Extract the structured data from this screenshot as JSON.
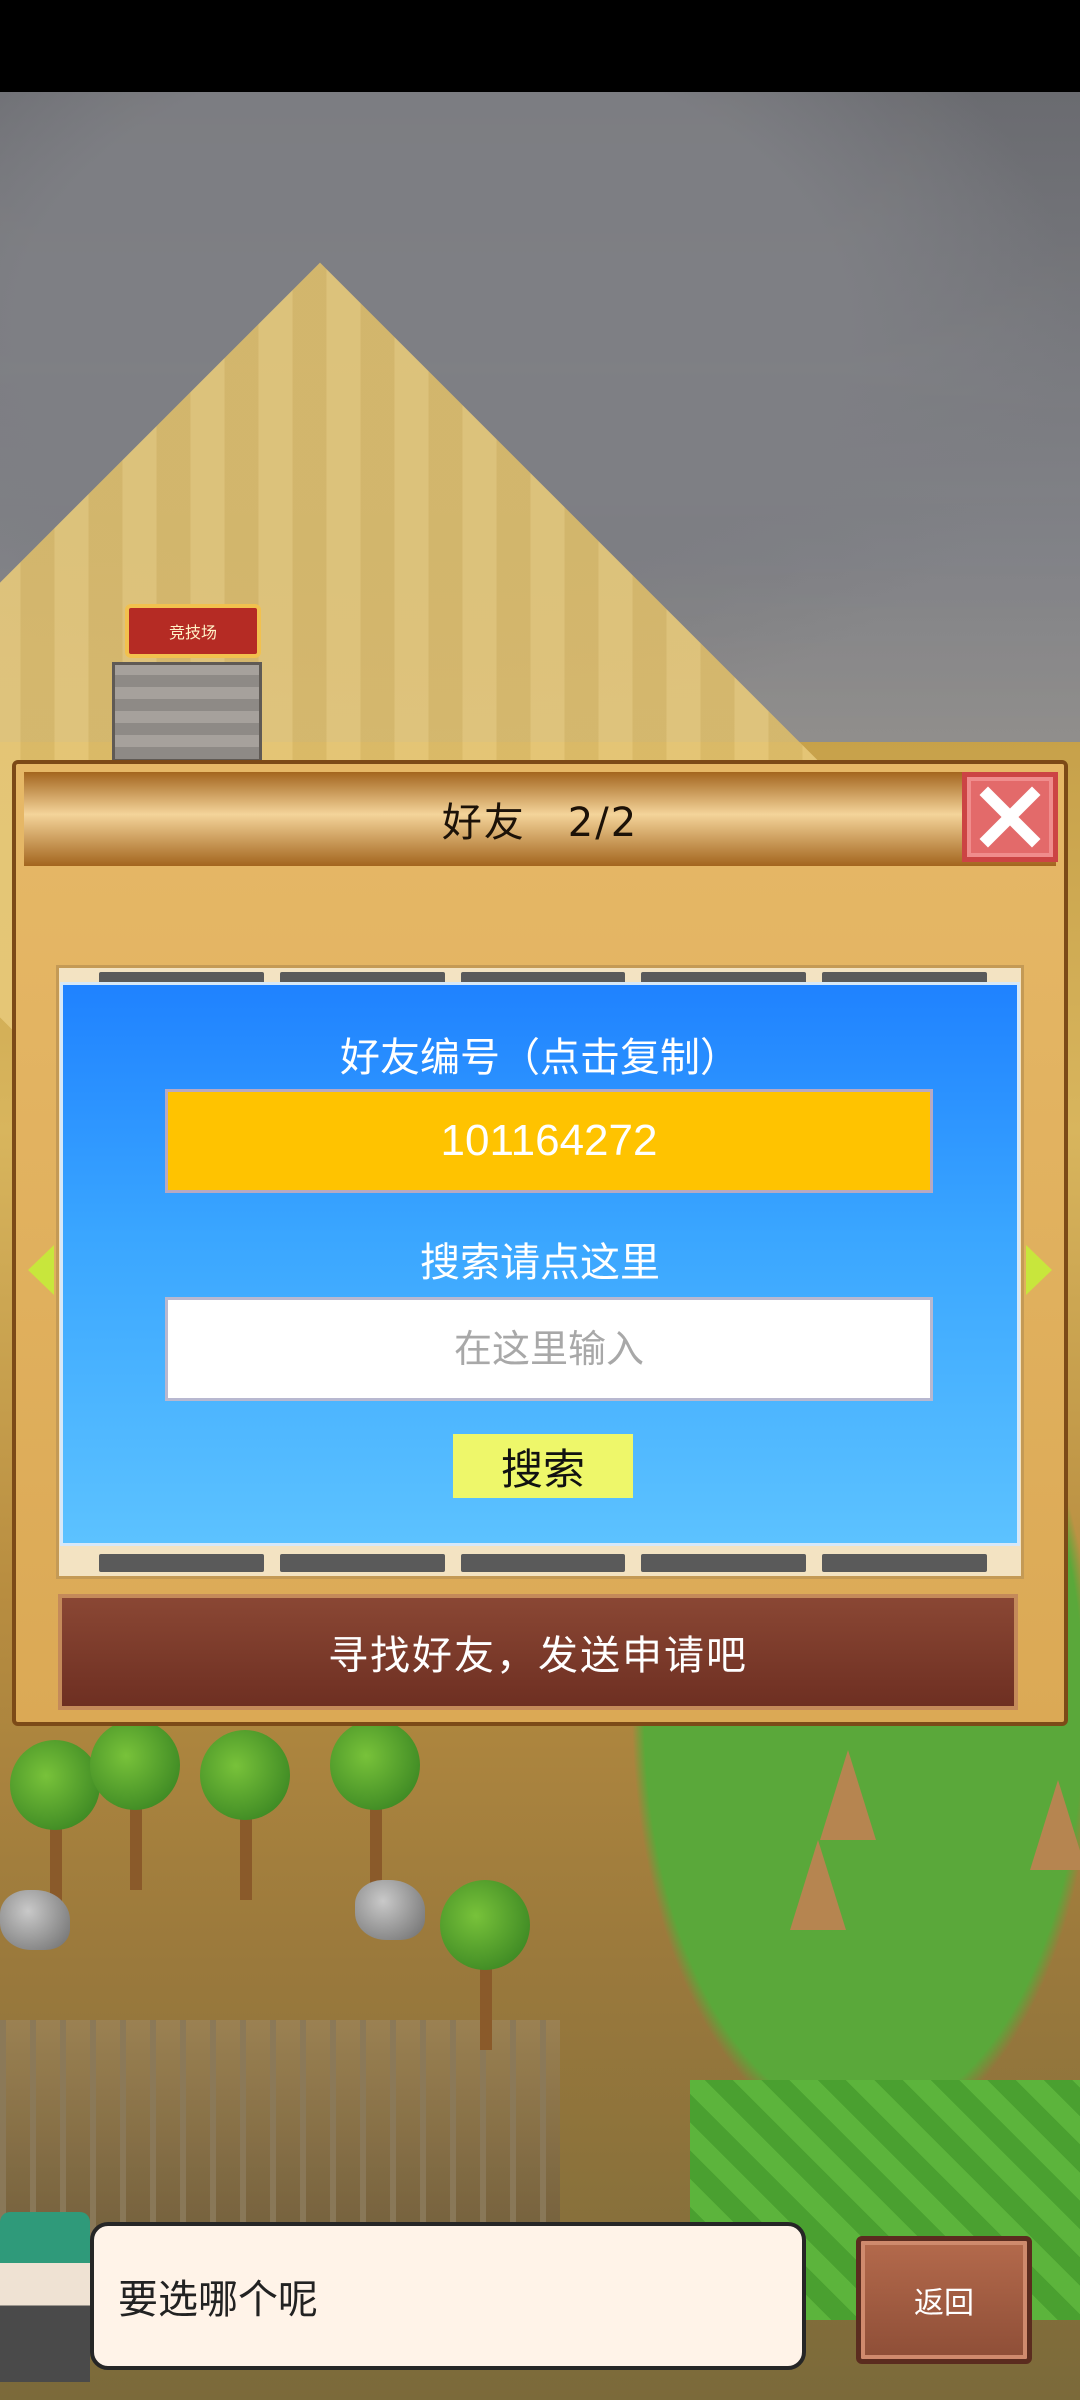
{
  "scene": {
    "arena_sign": "竞技场"
  },
  "friends_dialog": {
    "title": "好友　2/2",
    "friend_id_label": "好友编号（点击复制）",
    "friend_id": "101164272",
    "search_label": "搜索请点这里",
    "search_placeholder": "在这里输入",
    "search_button": "搜索",
    "hint": "寻找好友，发送申请吧"
  },
  "npc": {
    "message": "要选哪个呢"
  },
  "back_button": "返回",
  "icons": [
    "close-icon",
    "arrow-left-icon",
    "arrow-right-icon"
  ],
  "colors": {
    "panel_blue": "#1f82ff",
    "id_yellow": "#ffc300",
    "search_button_yellow": "#eef76a",
    "close_red": "#e36a6a",
    "hint_brown": "#7a3a28"
  }
}
